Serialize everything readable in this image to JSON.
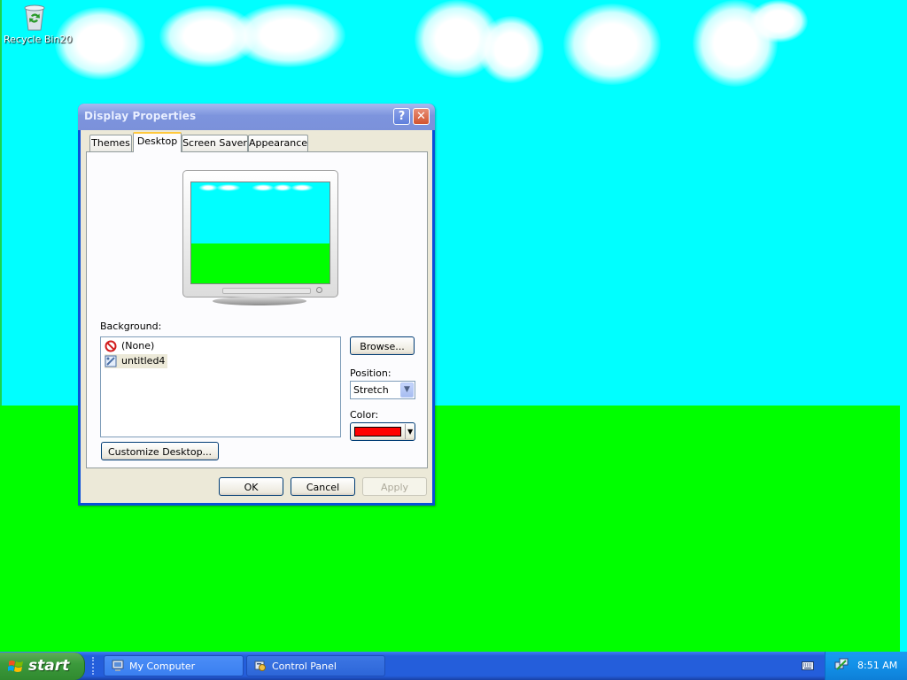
{
  "desktop": {
    "recycle_bin_label": "Recycle Bin20"
  },
  "dialog": {
    "title": "Display Properties",
    "help_glyph": "?",
    "close_glyph": "✕",
    "tabs": [
      {
        "label": "Themes",
        "active": false
      },
      {
        "label": "Desktop",
        "active": true
      },
      {
        "label": "Screen Saver",
        "active": false
      },
      {
        "label": "Appearance",
        "active": false
      }
    ],
    "background_label": "Background:",
    "background_items": [
      {
        "label": "(None)",
        "icon": "none-icon"
      },
      {
        "label": "untitled4",
        "icon": "image-file-icon"
      }
    ],
    "browse_label": "Browse...",
    "position_label": "Position:",
    "position_value": "Stretch",
    "color_label": "Color:",
    "color_value": "#ff0000",
    "customize_label": "Customize Desktop...",
    "ok_label": "OK",
    "cancel_label": "Cancel",
    "apply_label": "Apply"
  },
  "taskbar": {
    "start_label": "start",
    "buttons": [
      {
        "label": "My Computer",
        "icon": "my-computer-icon"
      },
      {
        "label": "Control Panel",
        "icon": "control-panel-icon"
      }
    ],
    "clock": "8:51 AM"
  },
  "colors": {
    "sky": "#00ffff",
    "grass": "#00ff00",
    "selected_color": "#ff0000",
    "title_bar": "#7d94dd",
    "taskbar": "#245edb",
    "start_green": "#3c9a3c"
  }
}
